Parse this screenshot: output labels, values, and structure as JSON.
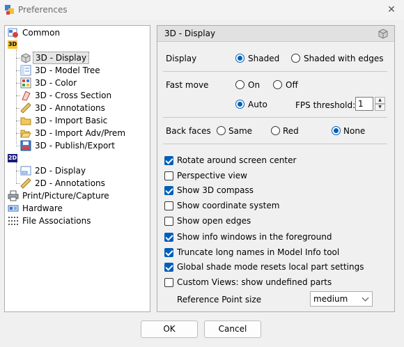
{
  "window": {
    "title": "Preferences",
    "close_icon": "close-icon"
  },
  "tree": {
    "badge_3d": "3D",
    "badge_2d": "2D",
    "items": [
      {
        "label": "Common"
      },
      {
        "label": "3D - Display"
      },
      {
        "label": "3D - Model Tree"
      },
      {
        "label": "3D - Color"
      },
      {
        "label": "3D - Cross Section"
      },
      {
        "label": "3D - Annotations"
      },
      {
        "label": "3D - Import Basic"
      },
      {
        "label": "3D - Import Adv/Prem"
      },
      {
        "label": "3D - Publish/Export"
      },
      {
        "label": "2D - Display"
      },
      {
        "label": "2D - Annotations"
      },
      {
        "label": "Print/Picture/Capture"
      },
      {
        "label": "Hardware"
      },
      {
        "label": "File Associations"
      }
    ],
    "selected": "3D - Display"
  },
  "panel": {
    "title": "3D - Display",
    "display": {
      "label": "Display",
      "opt1": "Shaded",
      "opt2": "Shaded with edges",
      "selected": "Shaded"
    },
    "fast_move": {
      "label": "Fast move",
      "on": "On",
      "off": "Off",
      "auto": "Auto",
      "selected": "Auto",
      "fps_label": "FPS threshold:",
      "fps_value": "1"
    },
    "back_faces": {
      "label": "Back faces",
      "same": "Same",
      "red": "Red",
      "none": "None",
      "selected": "None"
    },
    "checks": [
      {
        "label": "Rotate around screen center",
        "checked": true
      },
      {
        "label": "Perspective view",
        "checked": false
      },
      {
        "label": "Show 3D compass",
        "checked": true
      },
      {
        "label": "Show coordinate system",
        "checked": false
      },
      {
        "label": "Show open edges",
        "checked": false
      },
      {
        "label": "Show info windows in the foreground",
        "checked": true
      },
      {
        "label": "Truncate long names in Model Info tool",
        "checked": true
      },
      {
        "label": "Global shade mode resets local part settings",
        "checked": true
      },
      {
        "label": "Custom Views: show undefined parts",
        "checked": false
      }
    ],
    "ref_point": {
      "label": "Reference Point size",
      "value": "medium"
    }
  },
  "buttons": {
    "ok": "OK",
    "cancel": "Cancel"
  }
}
